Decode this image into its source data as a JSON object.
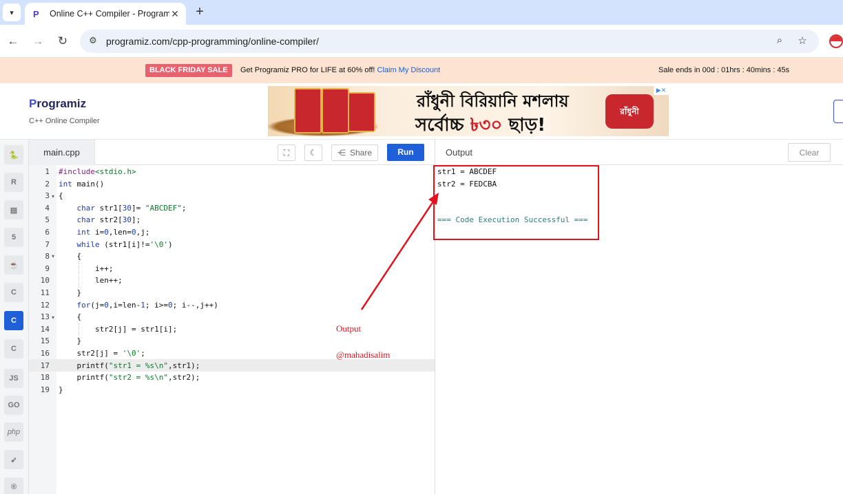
{
  "browser": {
    "tab_title": "Online C++ Compiler - Programiz",
    "url": "programiz.com/cpp-programming/online-compiler/"
  },
  "promo": {
    "badge": "BLACK FRIDAY SALE",
    "message": "Get Programiz PRO for LIFE at 60% off!",
    "link": "Claim My Discount",
    "timer": "Sale ends in 00d : 01hrs : 40mins : 45s"
  },
  "header": {
    "logo": "rogramiz",
    "logo_initial": "P",
    "subtitle": "C++ Online Compiler"
  },
  "ad": {
    "line1": "রাঁধুনী বিরিয়ানি মশলায়",
    "line2a": "সর্বোচ্চ ",
    "line2b": "৳৩০",
    "line2c": " ছাড়!",
    "brand": "রাঁধুনী"
  },
  "editor": {
    "file_name": "main.cpp",
    "share_label": "Share",
    "run_label": "Run",
    "line_numbers": [
      "1",
      "2",
      "3",
      "4",
      "5",
      "6",
      "7",
      "8",
      "9",
      "10",
      "11",
      "12",
      "13",
      "14",
      "15",
      "16",
      "17",
      "18",
      "19"
    ]
  },
  "sidebar": {
    "languages": [
      "python-icon",
      "r-icon",
      "sql-icon",
      "html-icon",
      "java-icon",
      "c-icon",
      "cpp-icon",
      "csharp-icon",
      "js-icon",
      "go-icon",
      "php-icon",
      "swift-icon",
      "rust-icon"
    ]
  },
  "output": {
    "title": "Output",
    "clear_label": "Clear",
    "line1": "str1 = ABCDEF",
    "line2": "str2 = FEDCBA",
    "status": "=== Code Execution Successful ==="
  },
  "annotation": {
    "label": "Output",
    "handle": "@mahadisalim"
  },
  "colors": {
    "accent": "#1f5fd8",
    "annotation": "#e0141e",
    "promo_bg": "#fde3d1"
  }
}
